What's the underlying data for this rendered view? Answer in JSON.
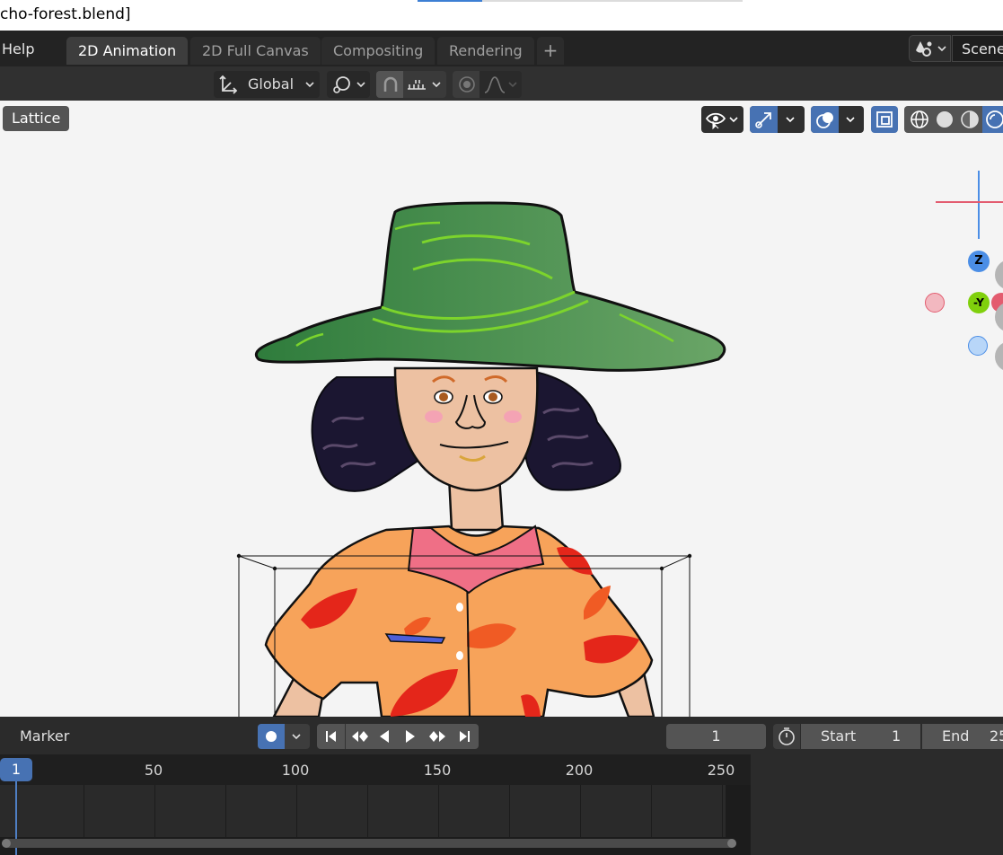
{
  "window": {
    "title": "cho-forest.blend]"
  },
  "menubar": {
    "help": "Help",
    "tabs": [
      "2D Animation",
      "2D Full Canvas",
      "Compositing",
      "Rendering"
    ],
    "add_tab": "+",
    "scene": "Scene"
  },
  "toolbar": {
    "orientation": "Global"
  },
  "viewport": {
    "mode_button": "Lattice",
    "gizmo": {
      "z": "Z",
      "y": "-Y"
    }
  },
  "timeline": {
    "marker": "Marker",
    "current_frame": "1",
    "start_label": "Start",
    "start_value": "1",
    "end_label": "End",
    "end_value": "25",
    "ruler_labels": [
      "50",
      "100",
      "150",
      "200",
      "250"
    ],
    "playhead_label": "1"
  },
  "colors": {
    "accent": "#4772b3",
    "hat": "#4e8a4f",
    "shirt": "#f7a35a",
    "collar": "#ef6f86",
    "skin": "#edc1a2",
    "hair": "#1b1631"
  }
}
